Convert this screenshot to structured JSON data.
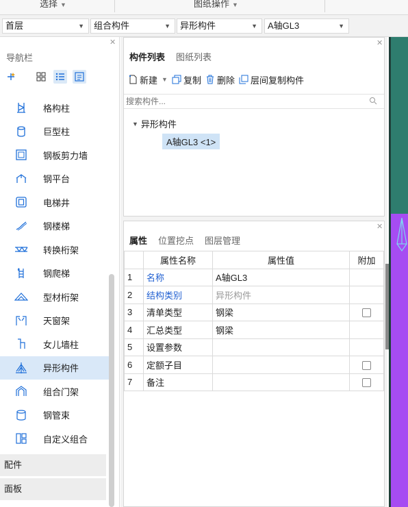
{
  "ribbon": {
    "groups": [
      {
        "label": "选择"
      },
      {
        "label": "图纸操作"
      }
    ]
  },
  "selectors": [
    {
      "value": "首层"
    },
    {
      "value": "组合构件"
    },
    {
      "value": "异形构件"
    },
    {
      "value": "A轴GL3"
    }
  ],
  "nav": {
    "title": "导航栏",
    "items": [
      {
        "label": "格构柱",
        "icon": "lattice-column-icon"
      },
      {
        "label": "巨型柱",
        "icon": "mega-column-icon"
      },
      {
        "label": "钢板剪力墙",
        "icon": "steel-shear-wall-icon"
      },
      {
        "label": "钢平台",
        "icon": "steel-platform-icon"
      },
      {
        "label": "电梯井",
        "icon": "elevator-shaft-icon"
      },
      {
        "label": "钢楼梯",
        "icon": "steel-stair-icon"
      },
      {
        "label": "转换桁架",
        "icon": "transfer-truss-icon"
      },
      {
        "label": "钢爬梯",
        "icon": "steel-ladder-icon"
      },
      {
        "label": "型材桁架",
        "icon": "profile-truss-icon"
      },
      {
        "label": "天窗架",
        "icon": "skylight-frame-icon"
      },
      {
        "label": "女儿墙柱",
        "icon": "parapet-column-icon"
      },
      {
        "label": "异形构件",
        "icon": "special-shaped-member-icon"
      },
      {
        "label": "组合门架",
        "icon": "portal-frame-icon"
      },
      {
        "label": "钢管束",
        "icon": "steel-tube-bundle-icon"
      },
      {
        "label": "自定义组合",
        "icon": "custom-combination-icon"
      }
    ],
    "selected_index": 11,
    "sections": [
      {
        "label": "配件"
      },
      {
        "label": "面板"
      }
    ]
  },
  "components": {
    "tabs": [
      {
        "label": "构件列表"
      },
      {
        "label": "图纸列表"
      }
    ],
    "toolbar": {
      "new_label": "新建",
      "copy_label": "复制",
      "delete_label": "删除",
      "floor_copy_label": "层间复制构件"
    },
    "search_placeholder": "搜索构件...",
    "tree": {
      "root": "异形构件",
      "child": "A轴GL3 <1>"
    }
  },
  "properties": {
    "tabs": [
      {
        "label": "属性"
      },
      {
        "label": "位置挖点"
      },
      {
        "label": "图层管理"
      }
    ],
    "headers": {
      "name": "属性名称",
      "value": "属性值",
      "attach": "附加"
    },
    "rows": [
      {
        "num": "1",
        "name": "名称",
        "value": "A轴GL3",
        "checkbox": false
      },
      {
        "num": "2",
        "name": "结构类别",
        "value": "异形构件",
        "checkbox": false
      },
      {
        "num": "3",
        "name": "清单类型",
        "value": "钢梁",
        "checkbox": true
      },
      {
        "num": "4",
        "name": "汇总类型",
        "value": "钢梁",
        "checkbox": false
      },
      {
        "num": "5",
        "name": "设置参数",
        "value": "",
        "checkbox": false
      },
      {
        "num": "6",
        "name": "定额子目",
        "value": "",
        "checkbox": true
      },
      {
        "num": "7",
        "name": "备注",
        "value": "",
        "checkbox": true
      }
    ]
  },
  "colors": {
    "accent_blue": "#1f5fd1",
    "selection": "#d9e8f8",
    "canvas_purple": "#a64cf2",
    "canvas_green": "#2e7d6e"
  }
}
